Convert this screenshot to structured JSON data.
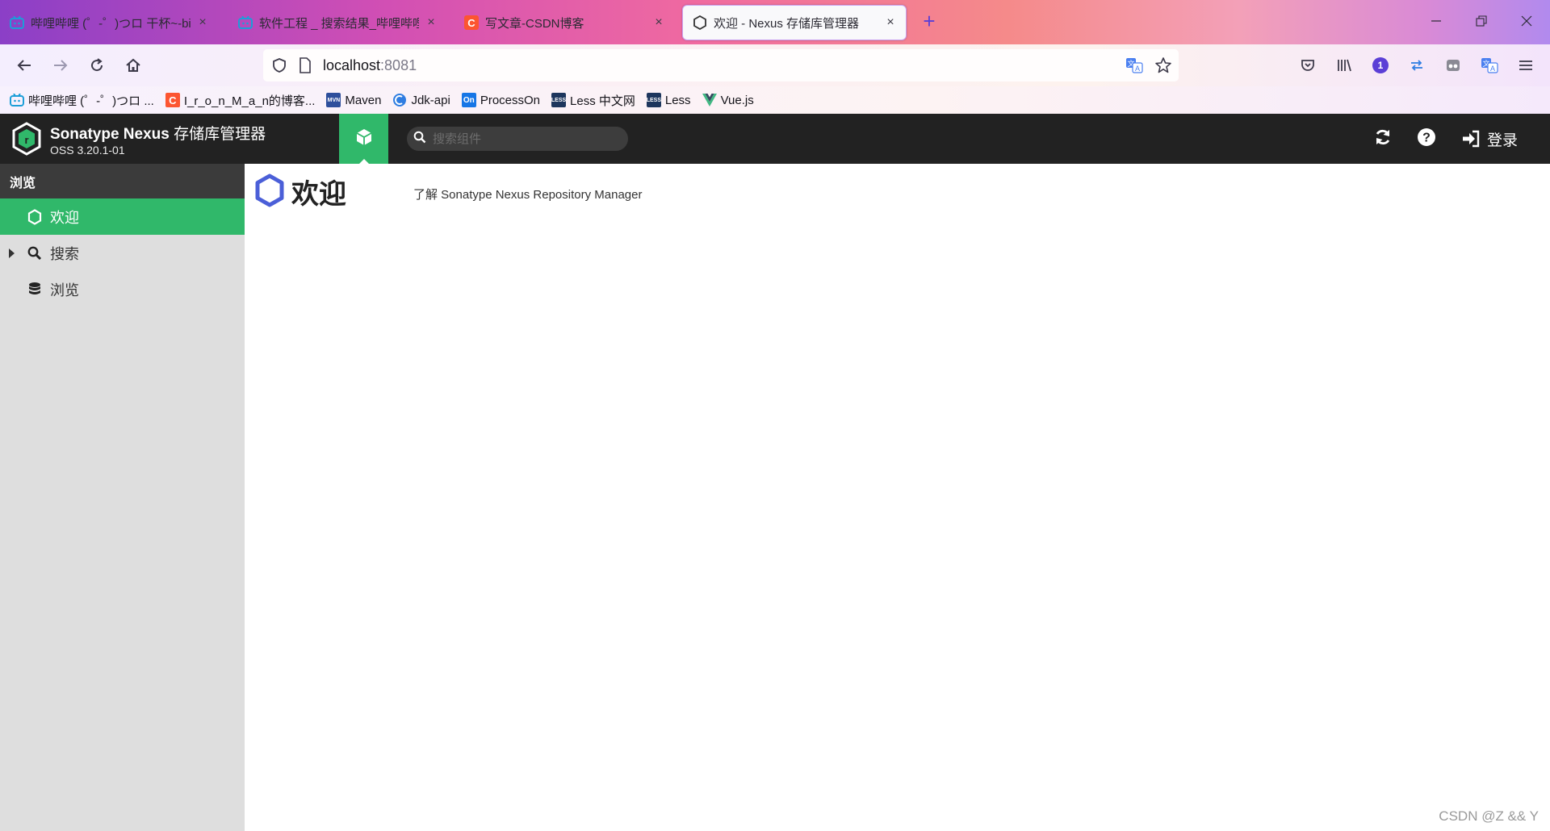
{
  "browser": {
    "tabs": [
      {
        "label": "哔哩哔哩 (゜-゜)つロ 干杯~-bil",
        "favicon": "bilibili-icon"
      },
      {
        "label": "软件工程 _ 搜索结果_哔哩哔哩_",
        "favicon": "bilibili-icon"
      },
      {
        "label": "写文章-CSDN博客",
        "favicon": "csdn-icon"
      },
      {
        "label": "欢迎 - Nexus 存储库管理器",
        "favicon": "nexus-icon",
        "active": true
      }
    ],
    "close_glyph": "×",
    "new_tab_glyph": "+",
    "url_host": "localhost",
    "url_port": ":8081",
    "bookmarks": [
      {
        "label": "哔哩哔哩 (゜-゜)つロ ...",
        "icon": "bilibili-icon"
      },
      {
        "label": "I_r_o_n_M_a_n的博客...",
        "icon": "csdn-icon"
      },
      {
        "label": "Maven",
        "icon": "maven-icon"
      },
      {
        "label": "Jdk-api",
        "icon": "jdk-icon"
      },
      {
        "label": "ProcessOn",
        "icon": "processon-icon"
      },
      {
        "label": "Less 中文网",
        "icon": "less-icon"
      },
      {
        "label": "Less",
        "icon": "less-icon"
      },
      {
        "label": "Vue.js",
        "icon": "vue-icon"
      }
    ],
    "extension_badge": "1",
    "accent": "#5b3fd6"
  },
  "nexus": {
    "header": {
      "title_en": "Sonatype Nexus",
      "title_cn": "存储库管理器",
      "version": "OSS 3.20.1-01",
      "search_placeholder": "搜索组件",
      "signin_label": "登录"
    },
    "sidebar": {
      "heading": "浏览",
      "items": [
        {
          "label": "欢迎",
          "icon": "hexagon-icon",
          "active": true
        },
        {
          "label": "搜索",
          "icon": "search-icon",
          "expandable": true
        },
        {
          "label": "浏览",
          "icon": "database-icon"
        }
      ]
    },
    "main": {
      "title": "欢迎",
      "subtitle": "了解 Sonatype Nexus Repository Manager"
    },
    "colors": {
      "green": "#30b86a",
      "header": "#222222",
      "hexagon": "#4b5fd8"
    }
  },
  "watermark": "CSDN @Z && Y"
}
